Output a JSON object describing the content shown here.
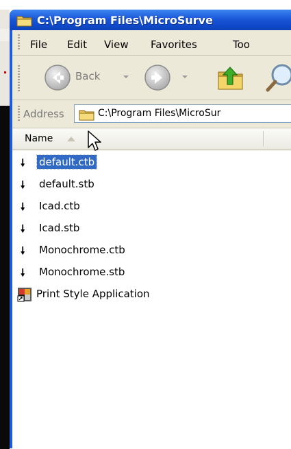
{
  "window": {
    "title": "C:\\Program Files\\MicroSurve"
  },
  "menubar": {
    "items": [
      "File",
      "Edit",
      "View",
      "Favorites",
      "Too"
    ]
  },
  "toolbar": {
    "back_label": "Back"
  },
  "address": {
    "label": "Address",
    "value": "C:\\Program Files\\MicroSur"
  },
  "list": {
    "column_name": "Name",
    "items": [
      {
        "label": "default.ctb",
        "icon": "download-arrow-icon",
        "selected": true
      },
      {
        "label": "default.stb",
        "icon": "download-arrow-icon",
        "selected": false
      },
      {
        "label": "Icad.ctb",
        "icon": "download-arrow-icon",
        "selected": false
      },
      {
        "label": "Icad.stb",
        "icon": "download-arrow-icon",
        "selected": false
      },
      {
        "label": "Monochrome.ctb",
        "icon": "download-arrow-icon",
        "selected": false
      },
      {
        "label": "Monochrome.stb",
        "icon": "download-arrow-icon",
        "selected": false
      },
      {
        "label": "Print Style Application",
        "icon": "application-shortcut-icon",
        "selected": false
      }
    ]
  },
  "colors": {
    "titlebar": "#1a57d8",
    "selection": "#316ac5",
    "chrome": "#ece9d8"
  }
}
